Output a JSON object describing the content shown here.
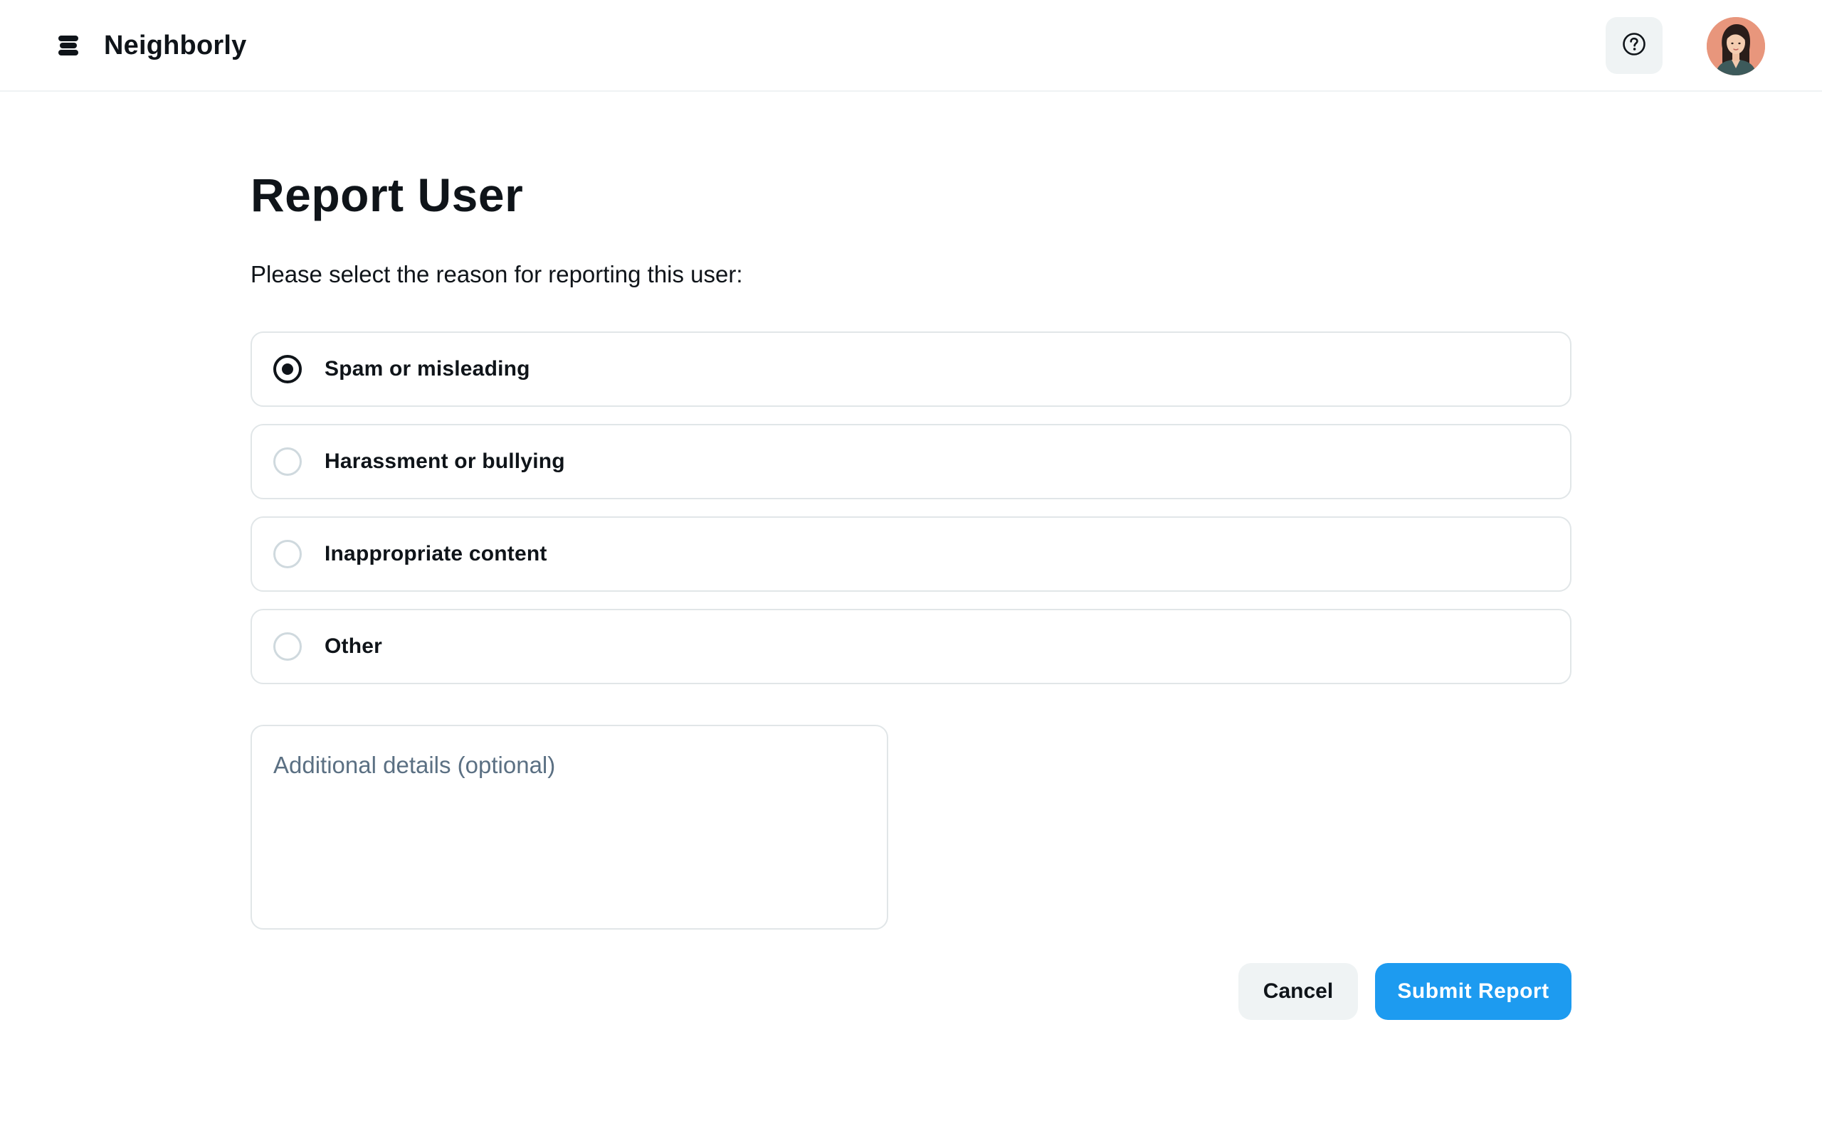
{
  "header": {
    "brand_name": "Neighborly",
    "brand_icon": "stack-logo-icon",
    "help_icon": "question-circle-icon",
    "avatar_icon": "user-avatar"
  },
  "main": {
    "title": "Report User",
    "prompt": "Please select the reason for reporting this user:",
    "options": [
      {
        "label": "Spam or misleading",
        "selected": true
      },
      {
        "label": "Harassment or bullying",
        "selected": false
      },
      {
        "label": "Inappropriate content",
        "selected": false
      },
      {
        "label": "Other",
        "selected": false
      }
    ],
    "details": {
      "value": "",
      "placeholder": "Additional details (optional)"
    },
    "cancel_label": "Cancel",
    "submit_label": "Submit Report"
  },
  "colors": {
    "accent": "#1d9bf0",
    "text": "#0f1419",
    "border": "#e1e6e8",
    "muted_surface": "#eff3f4",
    "placeholder": "#5b7083",
    "avatar_bg": "#e8967c"
  }
}
